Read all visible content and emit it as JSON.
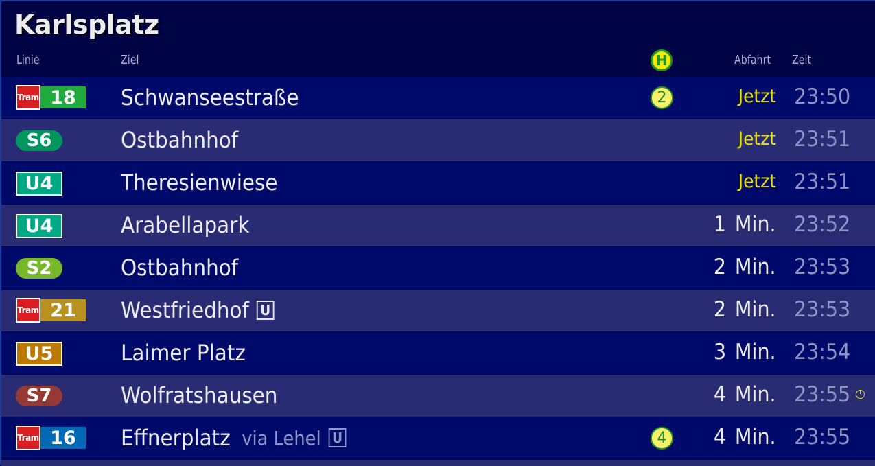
{
  "station": "Karlsplatz",
  "columns": {
    "linie": "Linie",
    "ziel": "Ziel",
    "platform_icon": "H",
    "abfahrt": "Abfahrt",
    "zeit": "Zeit"
  },
  "colors": {
    "now": "#e8e000",
    "tram_label": "#d91e22"
  },
  "departures": [
    {
      "type": "tram",
      "tram_label": "Tram",
      "line": "18",
      "line_color": "#1eaa3c",
      "destination": "Schwanseestraße",
      "via": "",
      "u_icon": "",
      "platform": "2",
      "departure": "Jetzt",
      "minutes": "",
      "min_label": "",
      "time": "23:50",
      "delayed": false
    },
    {
      "type": "sbahn",
      "tram_label": "",
      "line": "S6",
      "line_color": "#00975f",
      "destination": "Ostbahnhof",
      "via": "",
      "u_icon": "",
      "platform": "",
      "departure": "Jetzt",
      "minutes": "",
      "min_label": "",
      "time": "23:51",
      "delayed": false
    },
    {
      "type": "ubahn",
      "tram_label": "",
      "line": "U4",
      "line_color": "#00a984",
      "destination": "Theresienwiese",
      "via": "",
      "u_icon": "",
      "platform": "",
      "departure": "Jetzt",
      "minutes": "",
      "min_label": "",
      "time": "23:51",
      "delayed": false
    },
    {
      "type": "ubahn",
      "tram_label": "",
      "line": "U4",
      "line_color": "#00a984",
      "destination": "Arabellapark",
      "via": "",
      "u_icon": "",
      "platform": "",
      "departure": "",
      "minutes": "1",
      "min_label": "Min.",
      "time": "23:52",
      "delayed": false
    },
    {
      "type": "sbahn",
      "tram_label": "",
      "line": "S2",
      "line_color": "#76b82a",
      "destination": "Ostbahnhof",
      "via": "",
      "u_icon": "",
      "platform": "",
      "departure": "",
      "minutes": "2",
      "min_label": "Min.",
      "time": "23:53",
      "delayed": false
    },
    {
      "type": "tram",
      "tram_label": "Tram",
      "line": "21",
      "line_color": "#b8911e",
      "destination": "Westfriedhof",
      "via": "",
      "u_icon": "U",
      "platform": "",
      "departure": "",
      "minutes": "2",
      "min_label": "Min.",
      "time": "23:53",
      "delayed": false
    },
    {
      "type": "ubahn",
      "tram_label": "",
      "line": "U5",
      "line_color": "#bc7a00",
      "destination": "Laimer Platz",
      "via": "",
      "u_icon": "",
      "platform": "",
      "departure": "",
      "minutes": "3",
      "min_label": "Min.",
      "time": "23:54",
      "delayed": false
    },
    {
      "type": "sbahn",
      "tram_label": "",
      "line": "S7",
      "line_color": "#963833",
      "destination": "Wolfratshausen",
      "via": "",
      "u_icon": "",
      "platform": "",
      "departure": "",
      "minutes": "4",
      "min_label": "Min.",
      "time": "23:55",
      "delayed": true
    },
    {
      "type": "tram",
      "tram_label": "Tram",
      "line": "16",
      "line_color": "#0069b4",
      "destination": "Effnerplatz",
      "via": "via Lehel",
      "u_icon": "U",
      "platform": "4",
      "departure": "",
      "minutes": "4",
      "min_label": "Min.",
      "time": "23:55",
      "delayed": false
    }
  ]
}
